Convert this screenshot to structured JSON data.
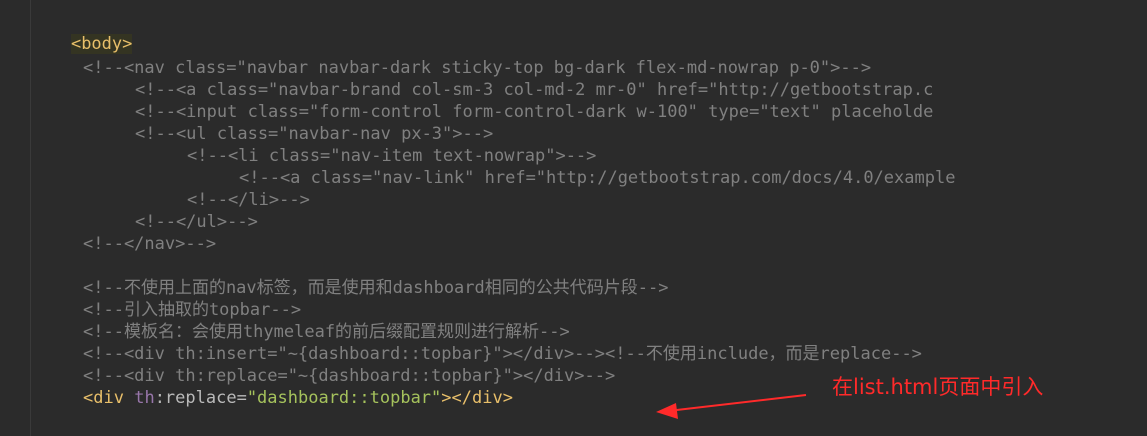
{
  "editor": {
    "lines": [
      "<body>",
      "<!--<nav class=\"navbar navbar-dark sticky-top bg-dark flex-md-nowrap p-0\">-->",
      "<!--<a class=\"navbar-brand col-sm-3 col-md-2 mr-0\" href=\"http://getbootstrap.c",
      "<!--<input class=\"form-control form-control-dark w-100\" type=\"text\" placeholde",
      "<!--<ul class=\"navbar-nav px-3\">-->",
      "<!--<li class=\"nav-item text-nowrap\">-->",
      "<!--<a class=\"nav-link\" href=\"http://getbootstrap.com/docs/4.0/example",
      "<!--</li>-->",
      "<!--</ul>-->",
      "<!--</nav>-->",
      "<!--不使用上面的nav标签，而是使用和dashboard相同的公共代码片段-->",
      "<!--引入抽取的topbar-->",
      "<!--模板名：会使用thymeleaf的前后缀配置规则进行解析-->",
      "<!--<div th:insert=\"~{dashboard::topbar}\"></div>--><!--不使用include，而是replace-->",
      "<!--<div th:replace=\"~{dashboard::topbar}\"></div>-->"
    ],
    "final_line": {
      "open": "<div",
      "ns": "th",
      "attr": ":replace=",
      "value": "\"dashboard::topbar\"",
      "close": "></div>"
    }
  },
  "annotation": {
    "text": "在list.html页面中引入",
    "color": "#ff2a2a"
  },
  "colors": {
    "background": "#2b2b2b",
    "tag": "#e8bf6a",
    "comment": "#808080",
    "string": "#a5c25c",
    "namespace": "#9876aa"
  }
}
